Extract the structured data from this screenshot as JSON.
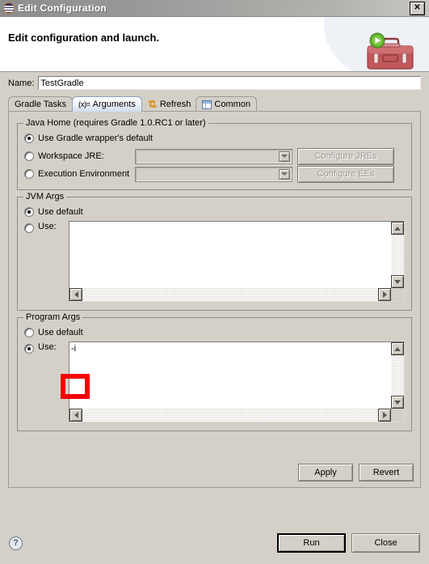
{
  "window": {
    "title": "Edit Configuration",
    "icon": "eclipse-circle-icon",
    "close_label": "✕"
  },
  "header": {
    "title": "Edit configuration and launch.",
    "icon": "toolbox-run-icon"
  },
  "name_field": {
    "label": "Name:",
    "value": "TestGradle",
    "placeholder": ""
  },
  "tabs": [
    {
      "label": "Gradle Tasks",
      "icon": null,
      "selected": false
    },
    {
      "label": "Arguments",
      "icon": "(x)=",
      "selected": true
    },
    {
      "label": "Refresh",
      "icon": "refresh-icon",
      "selected": false
    },
    {
      "label": "Common",
      "icon": "common-icon",
      "selected": false
    }
  ],
  "java_home": {
    "legend": "Java Home (requires Gradle 1.0.RC1 or later)",
    "options": [
      {
        "label": "Use Gradle wrapper's default",
        "checked": true
      },
      {
        "label": "Workspace JRE:",
        "checked": false
      },
      {
        "label": "Execution Environment",
        "checked": false
      }
    ],
    "workspace_jre_value": "",
    "execution_env_value": "",
    "configure_jres_label": "Configure JREs",
    "configure_ees_label": "Configure EEs"
  },
  "jvm_args": {
    "legend": "JVM Args",
    "use_default_label": "Use default",
    "use_default_checked": true,
    "use_label": "Use:",
    "use_checked": false,
    "value": ""
  },
  "program_args": {
    "legend": "Program Args",
    "use_default_label": "Use default",
    "use_default_checked": false,
    "use_label": "Use:",
    "use_checked": true,
    "value": "-i"
  },
  "panel_buttons": {
    "apply_label": "Apply",
    "revert_label": "Revert"
  },
  "dialog_buttons": {
    "help_label": "?",
    "run_label": "Run",
    "close_label": "Close"
  },
  "annotation": {
    "color": "#f40000",
    "target": "program-args-value"
  }
}
